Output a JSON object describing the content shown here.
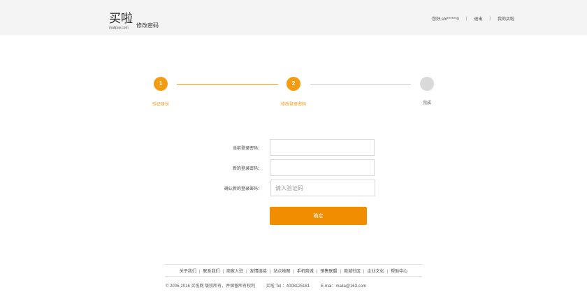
{
  "header": {
    "logo_main": "买啦",
    "logo_sub": "mailpay.com",
    "page_title": "修改密码",
    "greeting": "您好,shi******0",
    "logout": "退出",
    "my_purchases": "我的买啦"
  },
  "steps": [
    {
      "number": "1",
      "label": "验证身份",
      "state": "done"
    },
    {
      "number": "2",
      "label": "修改登录密码",
      "state": "current"
    },
    {
      "number": "",
      "label": "完成",
      "state": "pending"
    }
  ],
  "form": {
    "current_password_label": "当前登录密码：",
    "current_password_value": "",
    "new_password_label": "新的登录密码：",
    "new_password_value": "",
    "confirm_password_label": "确认新的登录密码：",
    "confirm_password_placeholder": "请入验证码",
    "submit_label": "确定"
  },
  "footer": {
    "links": [
      "关于我们",
      "联系我们",
      "商家入驻",
      "友情链接",
      "站点地图",
      "手机商城",
      "销售联盟",
      "商城社区",
      "企业文化",
      "帮助中心"
    ],
    "copyright": "©  2005-2016 买啦网 版权所有，并保留所有权利",
    "tel": "买啦 Tel ：4008125181",
    "email": "E-mai：maila@163.com"
  },
  "colors": {
    "accent": "#f39c12",
    "button": "#f18d00",
    "header_bg": "#f4f4f4",
    "inactive_step": "#d9d9d9"
  }
}
